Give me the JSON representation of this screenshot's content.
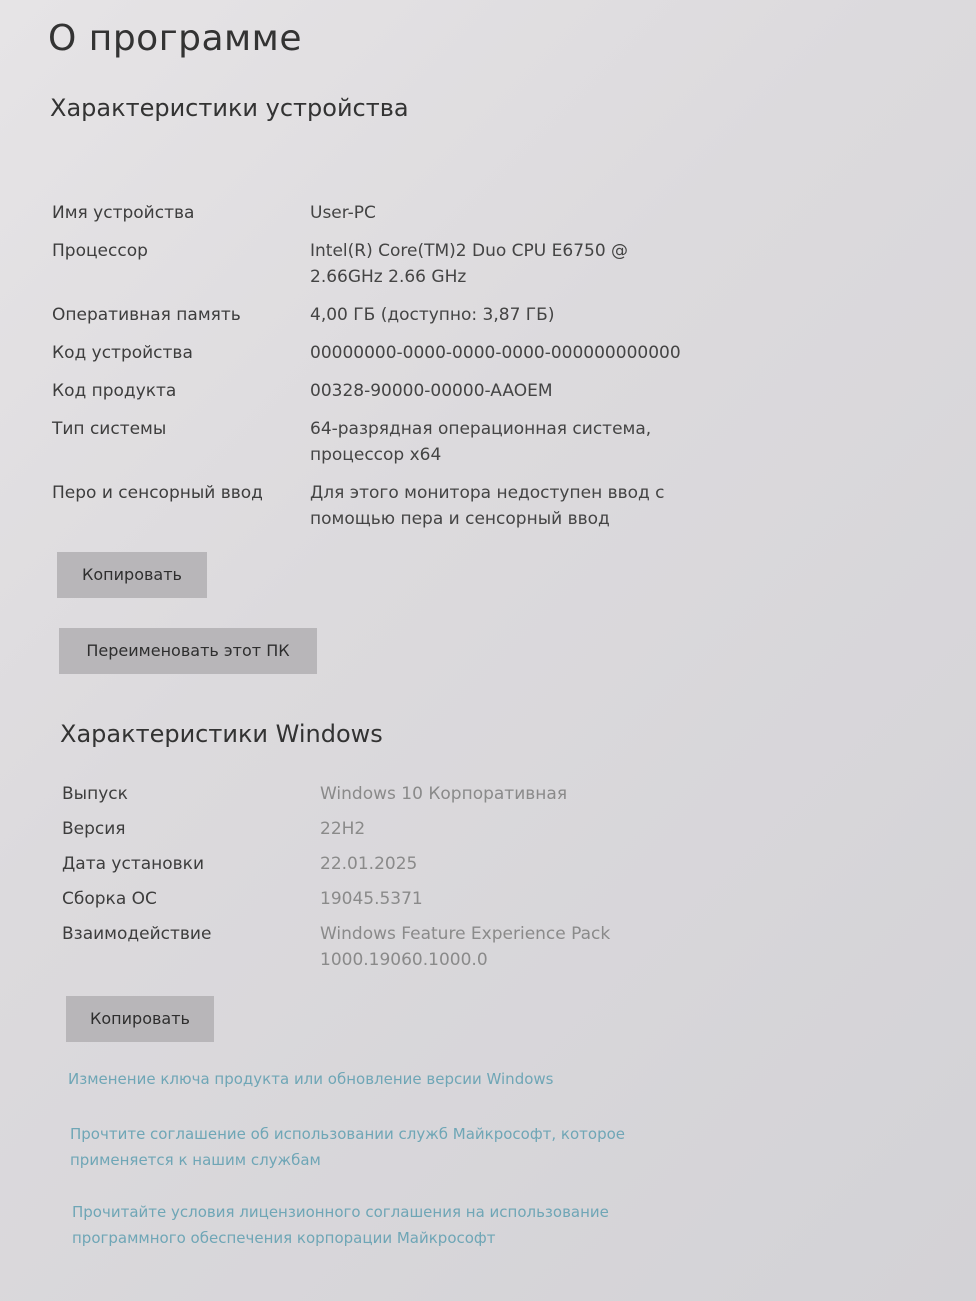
{
  "page": {
    "title": "О программе"
  },
  "device": {
    "heading": "Характеристики устройства",
    "rows": [
      {
        "label": "Имя устройства",
        "value": "User-PC"
      },
      {
        "label": "Процессор",
        "value": "Intel(R) Core(TM)2 Duo CPU     E6750  @ 2.66GHz   2.66 GHz"
      },
      {
        "label": "Оперативная память",
        "value": "4,00 ГБ (доступно: 3,87 ГБ)"
      },
      {
        "label": "Код устройства",
        "value": "00000000-0000-0000-0000-000000000000"
      },
      {
        "label": "Код продукта",
        "value": "00328-90000-00000-AAOEM"
      },
      {
        "label": "Тип системы",
        "value": "64-разрядная операционная система, процессор x64"
      },
      {
        "label": "Перо и сенсорный ввод",
        "value": "Для этого монитора недоступен ввод с помощью пера и сенсорный ввод"
      }
    ],
    "copy_button": "Копировать",
    "rename_button": "Переименовать этот ПК"
  },
  "windows": {
    "heading": "Характеристики Windows",
    "rows": [
      {
        "label": "Выпуск",
        "value": "Windows 10 Корпоративная"
      },
      {
        "label": "Версия",
        "value": "22H2"
      },
      {
        "label": "Дата установки",
        "value": "22.01.2025"
      },
      {
        "label": "Сборка ОС",
        "value": "19045.5371"
      },
      {
        "label": "Взаимодействие",
        "value": "Windows Feature Experience Pack 1000.19060.1000.0"
      }
    ],
    "copy_button": "Копировать"
  },
  "links": {
    "change_key": "Изменение ключа продукта или обновление версии Windows",
    "services_agreement": "Прочтите соглашение об использовании служб Майкрософт, которое применяется к нашим службам",
    "license_terms": "Прочитайте условия лицензионного соглашения на использование программного обеспечения корпорации Майкрософт"
  },
  "colors": {
    "background": "#dcdadd",
    "button": "#b8b6b9",
    "link": "#6fa6b6"
  }
}
